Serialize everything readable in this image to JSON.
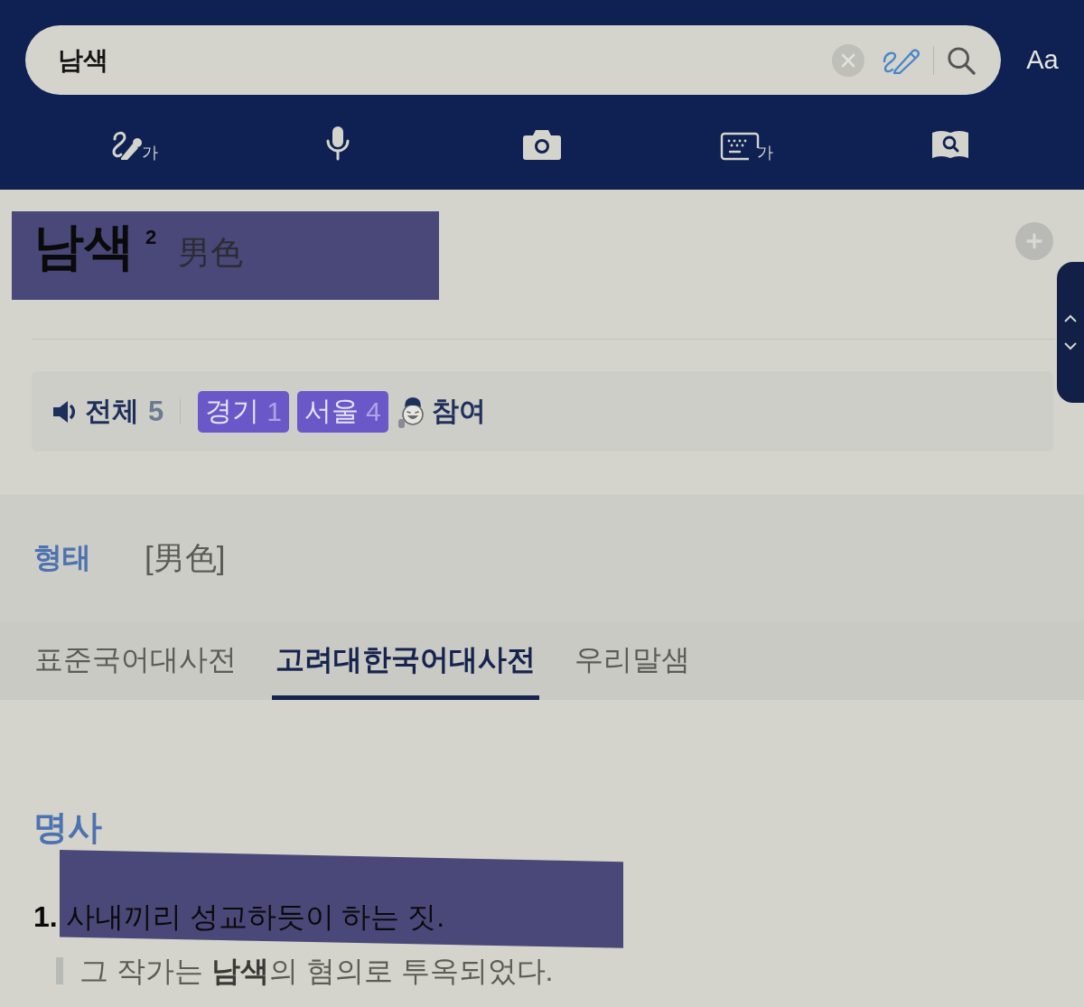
{
  "search": {
    "value": "남색"
  },
  "display_button": {
    "label": "Aa"
  },
  "input_tools": [
    {
      "kind": "handwriting",
      "label": "가"
    },
    {
      "kind": "voice"
    },
    {
      "kind": "camera"
    },
    {
      "kind": "keyboard",
      "label": "가"
    },
    {
      "kind": "book_search"
    }
  ],
  "entry": {
    "headword": "남색",
    "homonym_number": "2",
    "hanja": "男色",
    "highlighted": true
  },
  "pronunciation": {
    "all": {
      "label": "전체",
      "count": "5"
    },
    "regions": [
      {
        "label": "경기",
        "count": "1"
      },
      {
        "label": "서울",
        "count": "4"
      }
    ],
    "participate": {
      "label": "참여"
    }
  },
  "form": {
    "label": "형태",
    "value": "[男色]"
  },
  "dictionary_tabs": [
    {
      "label": "표준국어대사전",
      "selected": false
    },
    {
      "label": "고려대한국어대사전",
      "selected": true
    },
    {
      "label": "우리말샘",
      "selected": false
    }
  ],
  "part_of_speech": "명사",
  "senses": [
    {
      "number": "1.",
      "definition": "사내끼리 성교하듯이 하는 짓.",
      "highlighted": true,
      "examples": [
        "그 작가는 **남색**의 혐의로 투옥되었다."
      ]
    }
  ]
}
